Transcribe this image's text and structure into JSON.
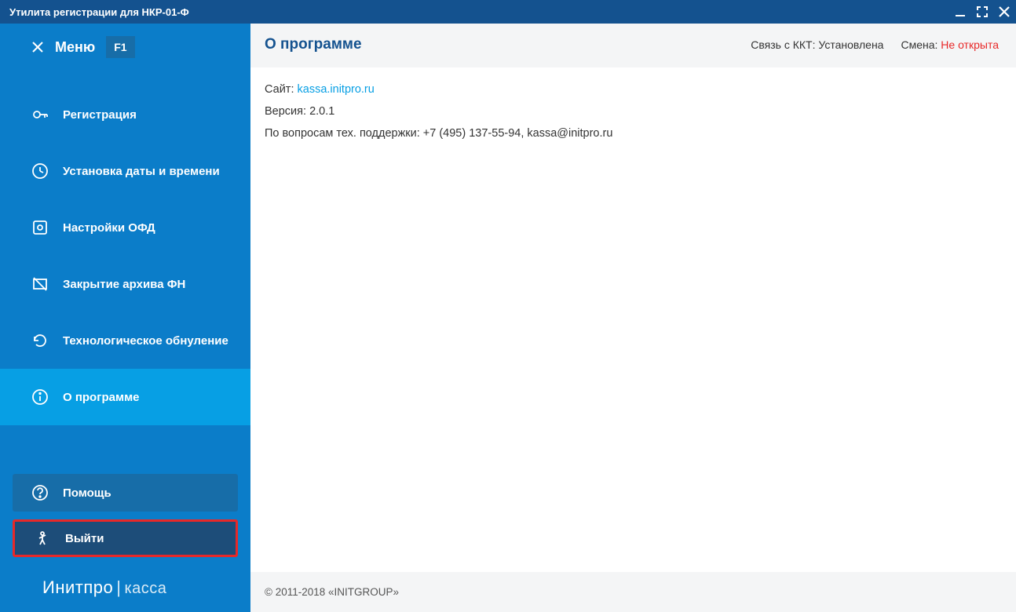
{
  "titlebar": {
    "title": "Утилита регистрации для НКР-01-Ф"
  },
  "menu": {
    "label": "Меню",
    "shortcut": "F1"
  },
  "nav": {
    "items": [
      {
        "label": "Регистрация"
      },
      {
        "label": "Установка даты и времени"
      },
      {
        "label": "Настройки ОФД"
      },
      {
        "label": "Закрытие архива ФН"
      },
      {
        "label": "Технологическое обнуление"
      },
      {
        "label": "О программе"
      }
    ]
  },
  "buttons": {
    "help": "Помощь",
    "exit": "Выйти"
  },
  "brand": {
    "main": "Инитпро",
    "sub": "касса"
  },
  "content": {
    "title": "О программе",
    "status": {
      "kkt_label": "Связь с ККТ:",
      "kkt_value": "Установлена",
      "shift_label": "Смена:",
      "shift_value": "Не открыта"
    },
    "about": {
      "site_label": "Сайт:",
      "site_value": "kassa.initpro.ru",
      "version_label": "Версия:",
      "version_value": "2.0.1",
      "support": "По вопросам тех. поддержки: +7 (495) 137-55-94, kassa@initpro.ru"
    },
    "footer": "© 2011-2018 «INITGROUP»"
  }
}
